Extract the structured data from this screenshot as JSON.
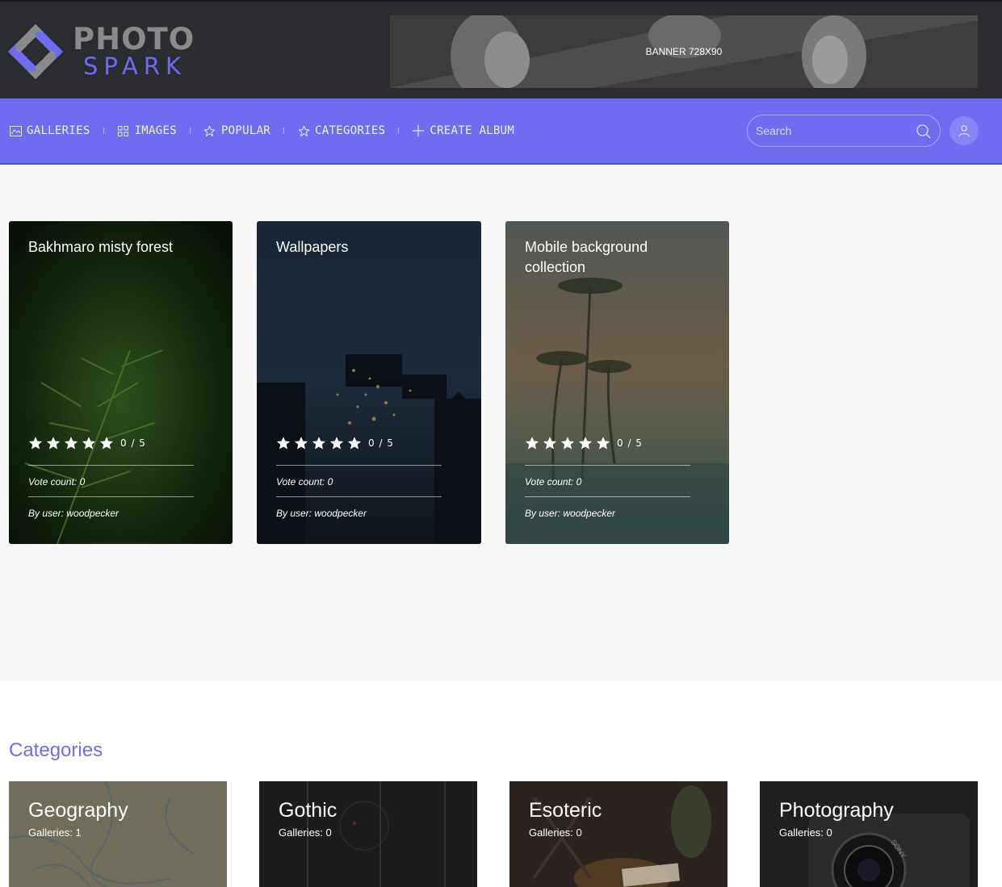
{
  "header": {
    "logo_word1": "PHOTO",
    "logo_word2": "SPARK",
    "banner_label": "BANNER 728X90"
  },
  "nav": {
    "items": [
      {
        "label": "GALLERIES",
        "icon": "image-icon"
      },
      {
        "label": "IMAGES",
        "icon": "grid-icon"
      },
      {
        "label": "POPULAR",
        "icon": "star-icon"
      },
      {
        "label": "CATEGORIES",
        "icon": "star-icon"
      },
      {
        "label": "CREATE ALBUM",
        "icon": "plus-icon"
      }
    ],
    "search_placeholder": "Search"
  },
  "galleries": [
    {
      "title": "Bakhmaro misty forest",
      "rating": "0 / 5",
      "votes": "Vote count: 0",
      "author": "By user: woodpecker"
    },
    {
      "title": "Wallpapers",
      "rating": "0 / 5",
      "votes": "Vote count: 0",
      "author": "By user: woodpecker"
    },
    {
      "title": "Mobile background collection",
      "rating": "0 / 5",
      "votes": "Vote count: 0",
      "author": "By user: woodpecker"
    }
  ],
  "categories": {
    "heading": "Categories",
    "items": [
      {
        "name": "Geography",
        "count": "Galleries: 1"
      },
      {
        "name": "Gothic",
        "count": "Galleries: 0"
      },
      {
        "name": "Esoteric",
        "count": "Galleries: 0"
      },
      {
        "name": "Photography",
        "count": "Galleries: 0"
      }
    ]
  },
  "colors": {
    "accent": "#6e6cf1",
    "header_bg": "#2b2c30",
    "page_bg": "#f7f7f7"
  }
}
